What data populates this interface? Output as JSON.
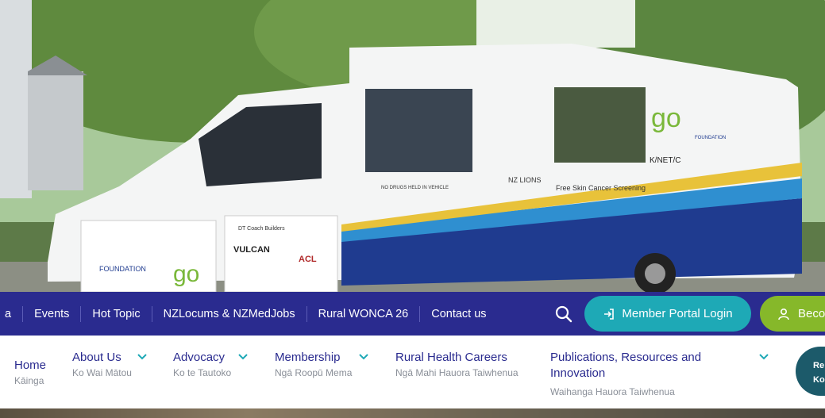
{
  "hero": {
    "image_alt": "Mobile skin cancer screening van",
    "van_signage": {
      "no_drugs": "NO DRUGS HELD IN VEHICLE",
      "nz_lions": "NZ LIONS",
      "screening": "Free Skin Cancer Screening",
      "kinetic": "K/NET/C",
      "foundation": "FOUNDATION",
      "go": "go",
      "sponsor_coach": "DT Coach Builders",
      "sponsor_vulcan": "VULCAN",
      "sponsor_acl": "ACL PAINT SHOP"
    }
  },
  "topnav": {
    "items": [
      {
        "label": "a"
      },
      {
        "label": "Events"
      },
      {
        "label": "Hot Topic"
      },
      {
        "label": "NZLocums & NZMedJobs"
      },
      {
        "label": "Rural WONCA 26"
      },
      {
        "label": "Contact us"
      }
    ],
    "search_icon": "search-icon",
    "portal_label": "Member Portal Login",
    "become_label": "Beco"
  },
  "mainmenu": {
    "items": [
      {
        "en": "Home",
        "mi": "Kāinga"
      },
      {
        "en": "About Us",
        "mi": "Ko Wai Mātou"
      },
      {
        "en": "Advocacy",
        "mi": "Ko te Tautoko"
      },
      {
        "en": "Membership",
        "mi": "Ngā Roopū Mema"
      },
      {
        "en": "Rural Health Careers",
        "mi": "Ngā Mahi Hauora Taiwhenua"
      },
      {
        "en": "Publications, Resources and Innovation",
        "mi": "Waihanga Hauora Taiwhenua"
      }
    ],
    "cta_line1": "Re",
    "cta_line2": "Ko"
  },
  "colors": {
    "navy": "#2a2b8f",
    "teal": "#1ea9b6",
    "green": "#86b82a",
    "cta": "#1c5a6a"
  }
}
